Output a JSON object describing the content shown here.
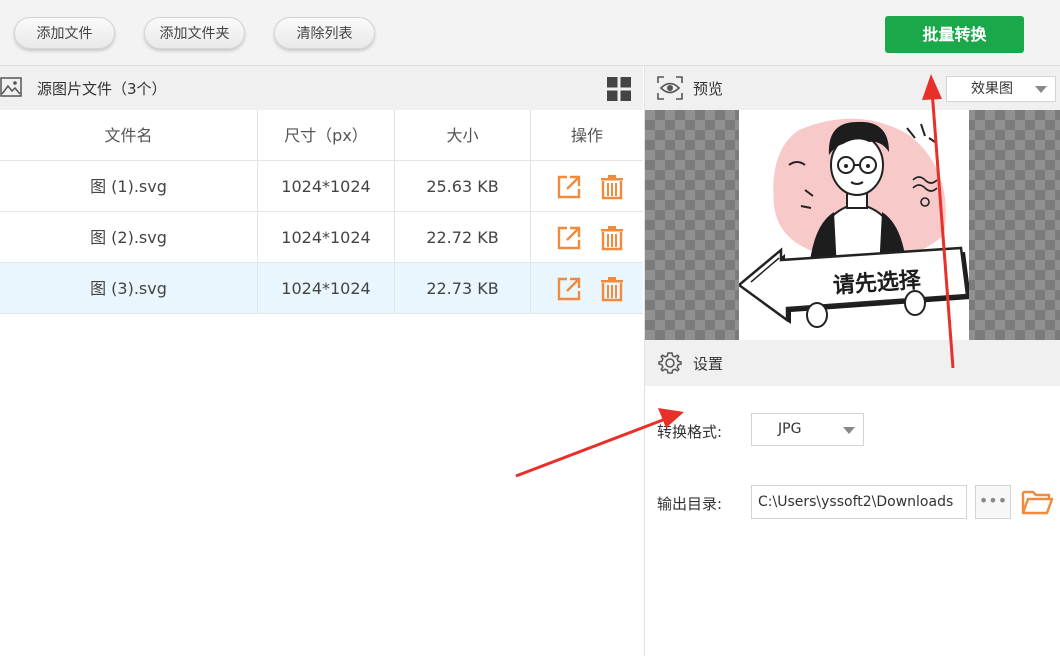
{
  "toolbar": {
    "add_file": "添加文件",
    "add_folder": "添加文件夹",
    "clear_list": "清除列表",
    "batch_convert": "批量转换"
  },
  "source_panel": {
    "title": "源图片文件（3个）",
    "columns": [
      "文件名",
      "尺寸（px）",
      "大小",
      "操作"
    ],
    "rows": [
      {
        "name": "图 (1).svg",
        "size_px": "1024*1024",
        "file_size": "25.63 KB"
      },
      {
        "name": "图 (2).svg",
        "size_px": "1024*1024",
        "file_size": "22.72 KB"
      },
      {
        "name": "图 (3).svg",
        "size_px": "1024*1024",
        "file_size": "22.73 KB"
      }
    ]
  },
  "preview": {
    "title": "预览",
    "mode_selected": "效果图",
    "placeholder_text": "请先选择"
  },
  "settings": {
    "title": "设置",
    "format_label": "转换格式:",
    "format_value": "JPG",
    "output_label": "输出目录:",
    "output_path": "C:\\Users\\yssoft2\\Downloads",
    "browse_label": "•••"
  },
  "colors": {
    "accent_green": "#1aa84a",
    "action_orange": "#f08a3c",
    "annotation_red": "#e8302a",
    "selected_row": "#eaf6fd"
  }
}
